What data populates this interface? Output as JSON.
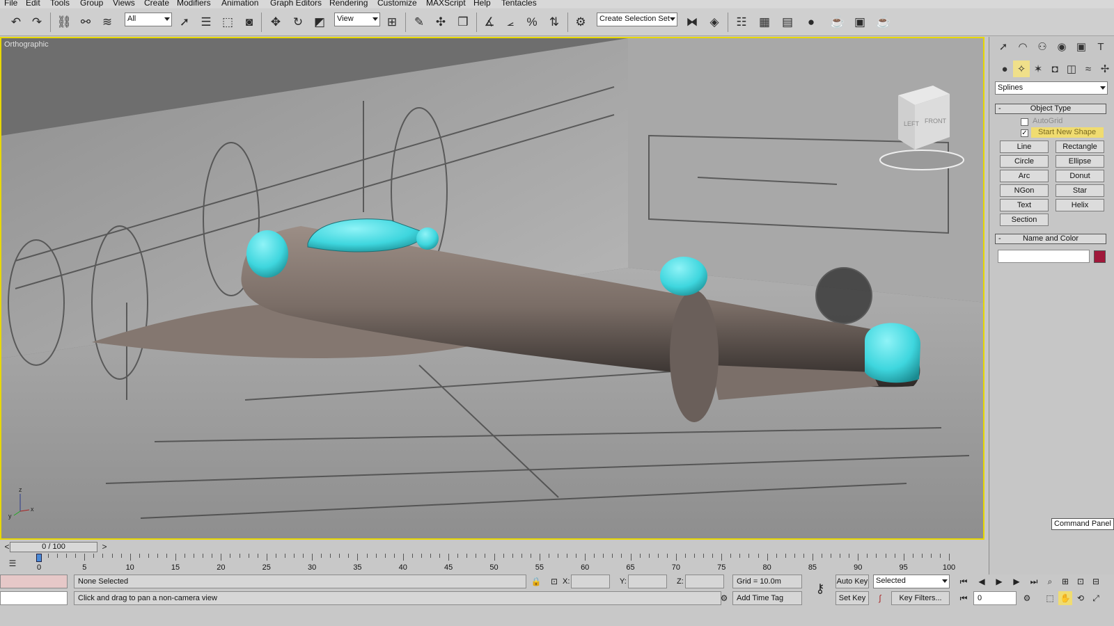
{
  "menu": [
    "File",
    "Edit",
    "Tools",
    "Group",
    "Views",
    "Create",
    "Modifiers",
    "Animation",
    "Graph Editors",
    "Rendering",
    "Customize",
    "MAXScript",
    "Help",
    "Tentacles"
  ],
  "toolbar": {
    "selection_filter": "All",
    "ref_coord": "View",
    "named_selection": "Create Selection Set",
    "icons": [
      "undo-icon",
      "redo-icon",
      "select-and-link-icon",
      "unlink-icon",
      "bind-space-warp-icon",
      "select-object-icon",
      "select-by-name-icon",
      "rectangular-region-icon",
      "window-crossing-icon",
      "move-icon",
      "rotate-icon",
      "scale-icon",
      "pivot-center-icon",
      "select-manipulate-icon",
      "keyboard-shortcut-icon",
      "snap-toggle-icon",
      "angle-snap-icon",
      "percent-snap-icon",
      "spinner-snap-icon",
      "edit-named-sets-icon",
      "mirror-icon",
      "align-icon",
      "layer-manager-icon",
      "curve-editor-icon",
      "schematic-view-icon",
      "material-editor-icon",
      "render-setup-icon",
      "rendered-frame-icon",
      "quick-render-icon"
    ]
  },
  "viewport": {
    "label": "Orthographic",
    "viewcube_left": "LEFT",
    "viewcube_front": "FRONT",
    "axis_x": "x",
    "axis_z": "z",
    "axis_y": "y"
  },
  "command_panel": {
    "category": "Splines",
    "object_type_title": "Object Type",
    "autogrid": "AutoGrid",
    "start_new_shape": "Start New Shape",
    "buttons": [
      "Line",
      "Rectangle",
      "Circle",
      "Ellipse",
      "Arc",
      "Donut",
      "NGon",
      "Star",
      "Text",
      "Helix",
      "Section"
    ],
    "name_color_title": "Name and Color",
    "color": "#a0183a",
    "tooltip": "Command Panel"
  },
  "timeline": {
    "slider": "0 / 100",
    "ticks": [
      "0",
      "5",
      "10",
      "15",
      "20",
      "25",
      "30",
      "35",
      "40",
      "45",
      "50",
      "55",
      "60",
      "65",
      "70",
      "75",
      "80",
      "85",
      "90",
      "95",
      "100"
    ]
  },
  "status": {
    "selection": "None Selected",
    "prompt": "Click and drag to pan a non-camera view",
    "x_label": "X:",
    "y_label": "Y:",
    "z_label": "Z:",
    "grid": "Grid = 10.0m",
    "add_time_tag": "Add Time Tag",
    "auto_key": "Auto Key",
    "set_key": "Set Key",
    "key_mode": "Selected",
    "key_filters": "Key Filters...",
    "frame": "0"
  },
  "colors": {
    "accent": "#e8d800",
    "nacelle": "#3ed6de",
    "fuselage": "#7a6d66"
  }
}
